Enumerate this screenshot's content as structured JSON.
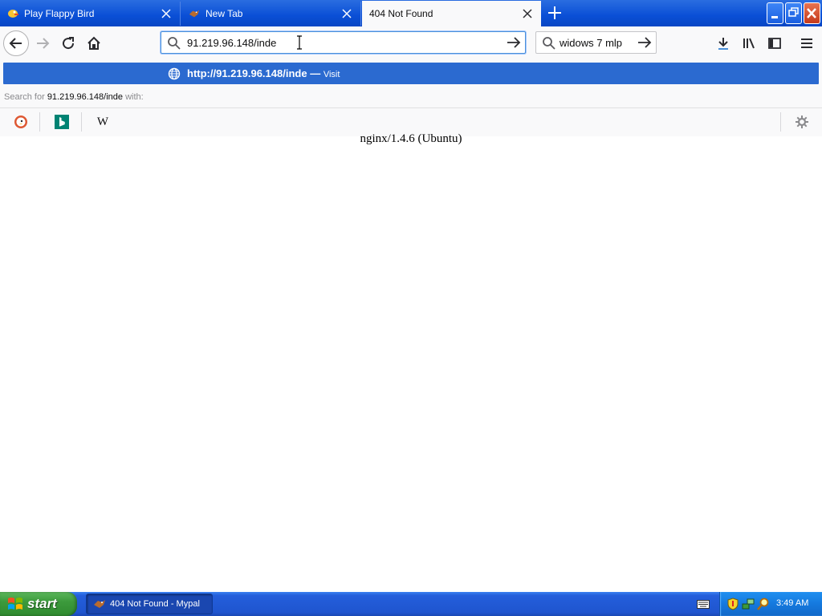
{
  "tabs": [
    {
      "label": "Play Flappy Bird",
      "favicon": "flappy-bird-icon",
      "active": false
    },
    {
      "label": "New Tab",
      "favicon": "mypal-icon",
      "active": false
    },
    {
      "label": "404 Not Found",
      "favicon": "",
      "active": true
    }
  ],
  "navbar": {
    "url_value": "91.219.96.148/inde",
    "search_value": "widows 7 mlp"
  },
  "dropdown": {
    "visit_url": "http://91.219.96.148/inde",
    "visit_sep": " — ",
    "visit_action": "Visit",
    "search_for_prefix": "Search for ",
    "search_for_query": "91.219.96.148/inde",
    "search_for_suffix": " with:",
    "engines": [
      "duckduckgo-icon",
      "bing-icon",
      "wikipedia-icon"
    ],
    "wikipedia_glyph": "W"
  },
  "page": {
    "server_signature": "nginx/1.4.6 (Ubuntu)"
  },
  "taskbar": {
    "start_label": "start",
    "task_label": "404 Not Found - Mypal",
    "clock": "3:49 AM"
  },
  "colors": {
    "accent": "#2b6ad0",
    "taskbar": "#245edb",
    "start": "#3c9a3c"
  }
}
